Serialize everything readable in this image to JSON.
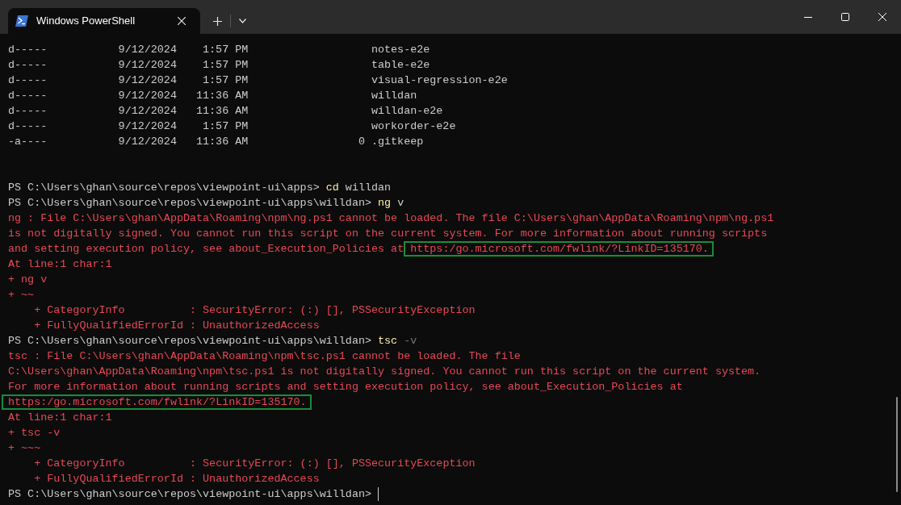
{
  "window": {
    "tab": {
      "title": "Windows PowerShell",
      "selected": true
    }
  },
  "listing": [
    {
      "mode": "d-----",
      "date": "9/12/2024",
      "time": "1:57 PM",
      "name": "notes-e2e"
    },
    {
      "mode": "d-----",
      "date": "9/12/2024",
      "time": "1:57 PM",
      "name": "table-e2e"
    },
    {
      "mode": "d-----",
      "date": "9/12/2024",
      "time": "1:57 PM",
      "name": "visual-regression-e2e"
    },
    {
      "mode": "d-----",
      "date": "9/12/2024",
      "time": "11:36 AM",
      "name": "willdan"
    },
    {
      "mode": "d-----",
      "date": "9/12/2024",
      "time": "11:36 AM",
      "name": "willdan-e2e"
    },
    {
      "mode": "d-----",
      "date": "9/12/2024",
      "time": "1:57 PM",
      "name": "workorder-e2e"
    },
    {
      "mode": "-a----",
      "date": "9/12/2024",
      "time": "11:36 AM",
      "length": "0",
      "name": ".gitkeep"
    }
  ],
  "session": [
    {
      "segments": [
        {
          "kind": "prompt",
          "text": "PS C:\\Users\\ghan\\source\\repos\\viewpoint-ui\\apps> "
        },
        {
          "kind": "command",
          "text": "cd"
        },
        {
          "kind": "argument",
          "text": " willdan"
        }
      ]
    },
    {
      "segments": [
        {
          "kind": "prompt",
          "text": "PS C:\\Users\\ghan\\source\\repos\\viewpoint-ui\\apps\\willdan> "
        },
        {
          "kind": "command",
          "text": "ng"
        },
        {
          "kind": "argument",
          "text": " v"
        }
      ]
    },
    {
      "segments": [
        {
          "kind": "error",
          "text": "ng : File C:\\Users\\ghan\\AppData\\Roaming\\npm\\ng.ps1 cannot be loaded. The file C:\\Users\\ghan\\AppData\\Roaming\\npm\\ng.ps1"
        }
      ]
    },
    {
      "segments": [
        {
          "kind": "error",
          "text": "is not digitally signed. You cannot run this script on the current system. For more information about running scripts"
        }
      ]
    },
    {
      "segments": [
        {
          "kind": "error",
          "text": "and setting execution policy, see about_Execution_Policies at "
        },
        {
          "kind": "highlighted",
          "text": "https:/go.microsoft.com/fwlink/?LinkID=135170."
        }
      ]
    },
    {
      "segments": [
        {
          "kind": "error",
          "text": "At line:1 char:1"
        }
      ]
    },
    {
      "segments": [
        {
          "kind": "error",
          "text": "+ ng v"
        }
      ]
    },
    {
      "segments": [
        {
          "kind": "error",
          "text": "+ ~~"
        }
      ]
    },
    {
      "segments": [
        {
          "kind": "error",
          "text": "    + CategoryInfo          : SecurityError: (:) [], PSSecurityException"
        }
      ]
    },
    {
      "segments": [
        {
          "kind": "error",
          "text": "    + FullyQualifiedErrorId : UnauthorizedAccess"
        }
      ]
    },
    {
      "segments": [
        {
          "kind": "prompt",
          "text": "PS C:\\Users\\ghan\\source\\repos\\viewpoint-ui\\apps\\willdan> "
        },
        {
          "kind": "command",
          "text": "tsc"
        },
        {
          "kind": "parameter",
          "text": " -v"
        }
      ]
    },
    {
      "segments": [
        {
          "kind": "error",
          "text": "tsc : File C:\\Users\\ghan\\AppData\\Roaming\\npm\\tsc.ps1 cannot be loaded. The file"
        }
      ]
    },
    {
      "segments": [
        {
          "kind": "error",
          "text": "C:\\Users\\ghan\\AppData\\Roaming\\npm\\tsc.ps1 is not digitally signed. You cannot run this script on the current system."
        }
      ]
    },
    {
      "segments": [
        {
          "kind": "error",
          "text": "For more information about running scripts and setting execution policy, see about_Execution_Policies at"
        }
      ]
    },
    {
      "segments": [
        {
          "kind": "highlighted",
          "text": "https:/go.microsoft.com/fwlink/?LinkID=135170."
        }
      ]
    },
    {
      "segments": [
        {
          "kind": "error",
          "text": "At line:1 char:1"
        }
      ]
    },
    {
      "segments": [
        {
          "kind": "error",
          "text": "+ tsc -v"
        }
      ]
    },
    {
      "segments": [
        {
          "kind": "error",
          "text": "+ ~~~"
        }
      ]
    },
    {
      "segments": [
        {
          "kind": "error",
          "text": "    + CategoryInfo          : SecurityError: (:) [], PSSecurityException"
        }
      ]
    },
    {
      "segments": [
        {
          "kind": "error",
          "text": "    + FullyQualifiedErrorId : UnauthorizedAccess"
        }
      ]
    },
    {
      "segments": [
        {
          "kind": "prompt",
          "text": "PS C:\\Users\\ghan\\source\\repos\\viewpoint-ui\\apps\\willdan> "
        }
      ],
      "cursor": true
    }
  ]
}
